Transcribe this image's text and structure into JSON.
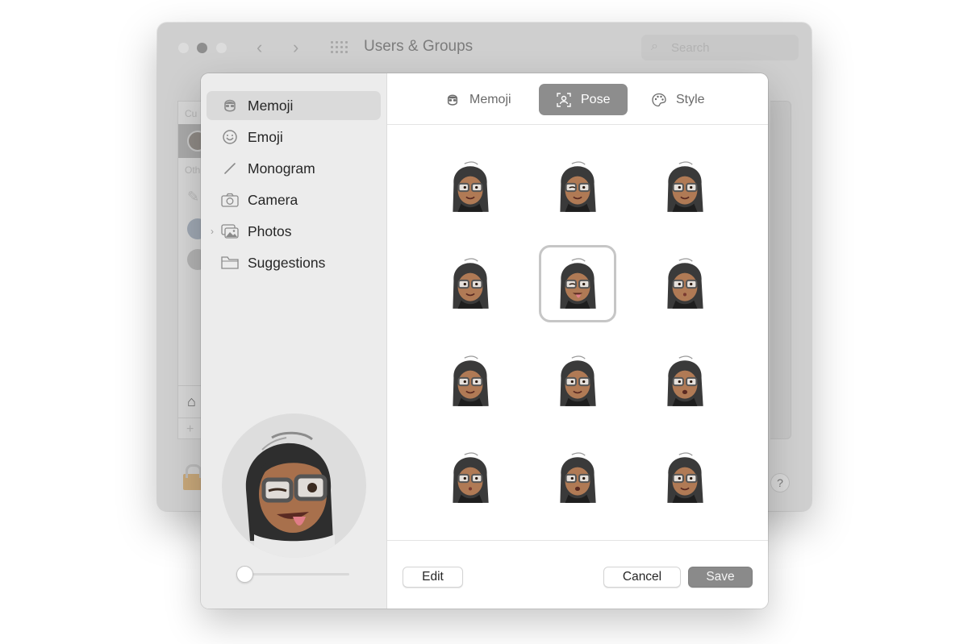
{
  "window": {
    "title": "Users & Groups",
    "search_placeholder": "Search",
    "list_labels": {
      "current": "Cu",
      "others": "Oth"
    },
    "help_label": "?"
  },
  "sheet": {
    "sidebar": {
      "items": [
        {
          "label": "Memoji",
          "icon": "memoji-face-icon",
          "active": true
        },
        {
          "label": "Emoji",
          "icon": "smiley-icon",
          "active": false
        },
        {
          "label": "Monogram",
          "icon": "pencil-line-icon",
          "active": false
        },
        {
          "label": "Camera",
          "icon": "camera-icon",
          "active": false
        },
        {
          "label": "Photos",
          "icon": "photos-icon",
          "active": false,
          "expandable": true
        },
        {
          "label": "Suggestions",
          "icon": "folder-icon",
          "active": false
        }
      ],
      "size_slider": {
        "value": 0.0
      }
    },
    "tabs": [
      {
        "label": "Memoji",
        "icon": "memoji-face-icon",
        "active": false
      },
      {
        "label": "Pose",
        "icon": "pose-frame-icon",
        "active": true
      },
      {
        "label": "Style",
        "icon": "palette-icon",
        "active": false
      }
    ],
    "poses": [
      {
        "expression": "smile-closed",
        "selected": false
      },
      {
        "expression": "wink-smirk",
        "selected": false
      },
      {
        "expression": "look-up",
        "selected": false
      },
      {
        "expression": "side-glance",
        "selected": false
      },
      {
        "expression": "wink-tongue-out",
        "selected": true
      },
      {
        "expression": "pout-look-up",
        "selected": false
      },
      {
        "expression": "look-sideways",
        "selected": false
      },
      {
        "expression": "content-smile",
        "selected": false
      },
      {
        "expression": "surprised",
        "selected": false
      },
      {
        "expression": "kiss",
        "selected": false
      },
      {
        "expression": "grin-look-up",
        "selected": false
      },
      {
        "expression": "smirk-look-up",
        "selected": false
      }
    ],
    "buttons": {
      "edit": "Edit",
      "cancel": "Cancel",
      "save": "Save"
    },
    "colors": {
      "selected_tab": "#8d8d8d",
      "save_button": "#8a8a8a",
      "skin": "#b07a55",
      "hair": "#3a3a3a"
    }
  }
}
